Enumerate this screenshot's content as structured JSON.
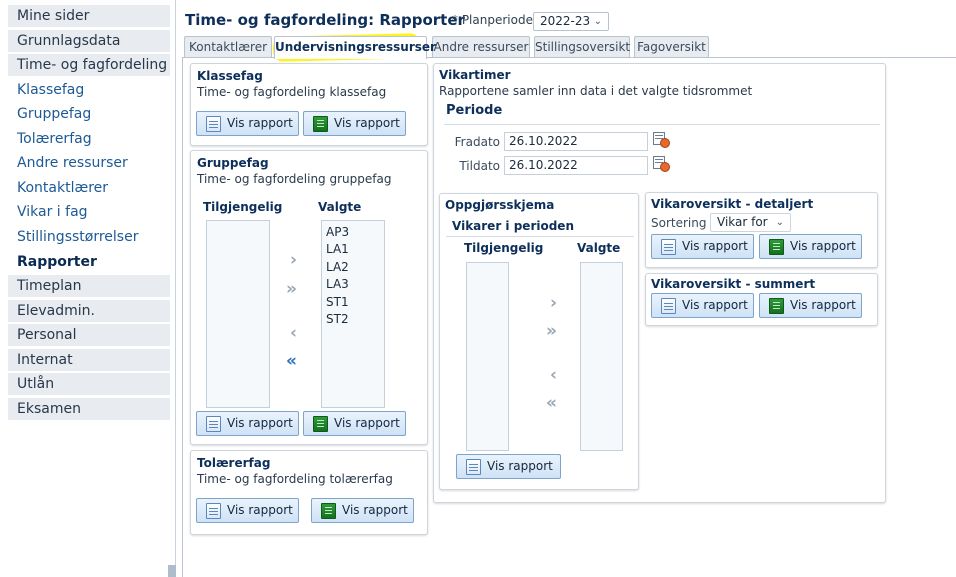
{
  "sidebar": {
    "items": [
      {
        "label": "Mine sider"
      },
      {
        "label": "Grunnlagsdata"
      },
      {
        "label": "Time- og fagfordeling"
      },
      {
        "label": "Klassefag"
      },
      {
        "label": "Gruppefag"
      },
      {
        "label": "Tolærerfag"
      },
      {
        "label": "Andre ressurser"
      },
      {
        "label": "Kontaktlærer"
      },
      {
        "label": "Vikar i fag"
      },
      {
        "label": "Stillingsstørrelser"
      },
      {
        "label": "Rapporter"
      },
      {
        "label": "Timeplan"
      },
      {
        "label": "Elevadmin."
      },
      {
        "label": "Personal"
      },
      {
        "label": "Internat"
      },
      {
        "label": "Utlån"
      },
      {
        "label": "Eksamen"
      }
    ]
  },
  "header": {
    "title": "Time- og fagfordeling: Rapporter",
    "planperiode_label": "* Planperiode",
    "planperiode_value": "2022-23"
  },
  "tabs": [
    {
      "label": "Kontaktlærer"
    },
    {
      "label": "Undervisningsressurser"
    },
    {
      "label": "Andre ressurser"
    },
    {
      "label": "Stillingsoversikt"
    },
    {
      "label": "Fagoversikt"
    }
  ],
  "common": {
    "vis_rapport": "Vis rapport",
    "tilgjengelig": "Tilgjengelig",
    "valgte": "Valgte"
  },
  "klassefag": {
    "title": "Klassefag",
    "subtitle": "Time- og fagfordeling klassefag"
  },
  "gruppefag": {
    "title": "Gruppefag",
    "subtitle": "Time- og fagfordeling gruppefag",
    "selected": [
      "AP3",
      "LA1",
      "LA2",
      "LA3",
      "ST1",
      "ST2"
    ]
  },
  "tolaererfag": {
    "title": "Tolærerfag",
    "subtitle": "Time- og fagfordeling tolærerfag"
  },
  "vikartimer": {
    "title": "Vikartimer",
    "subtitle": "Rapportene samler inn data i det valgte tidsrommet",
    "periode_heading": "Periode",
    "fradato_label": "Fradato",
    "fradato_value": "26.10.2022",
    "tildato_label": "Tildato",
    "tildato_value": "26.10.2022"
  },
  "oppgjorsskjema": {
    "title": "Oppgjørsskjema",
    "subheading": "Vikarer i perioden"
  },
  "vikaroversikt_detaljert": {
    "title": "Vikaroversikt - detaljert",
    "sortering_label": "Sortering",
    "sortering_value": "Vikar for"
  },
  "vikaroversikt_summert": {
    "title": "Vikaroversikt - summert"
  }
}
